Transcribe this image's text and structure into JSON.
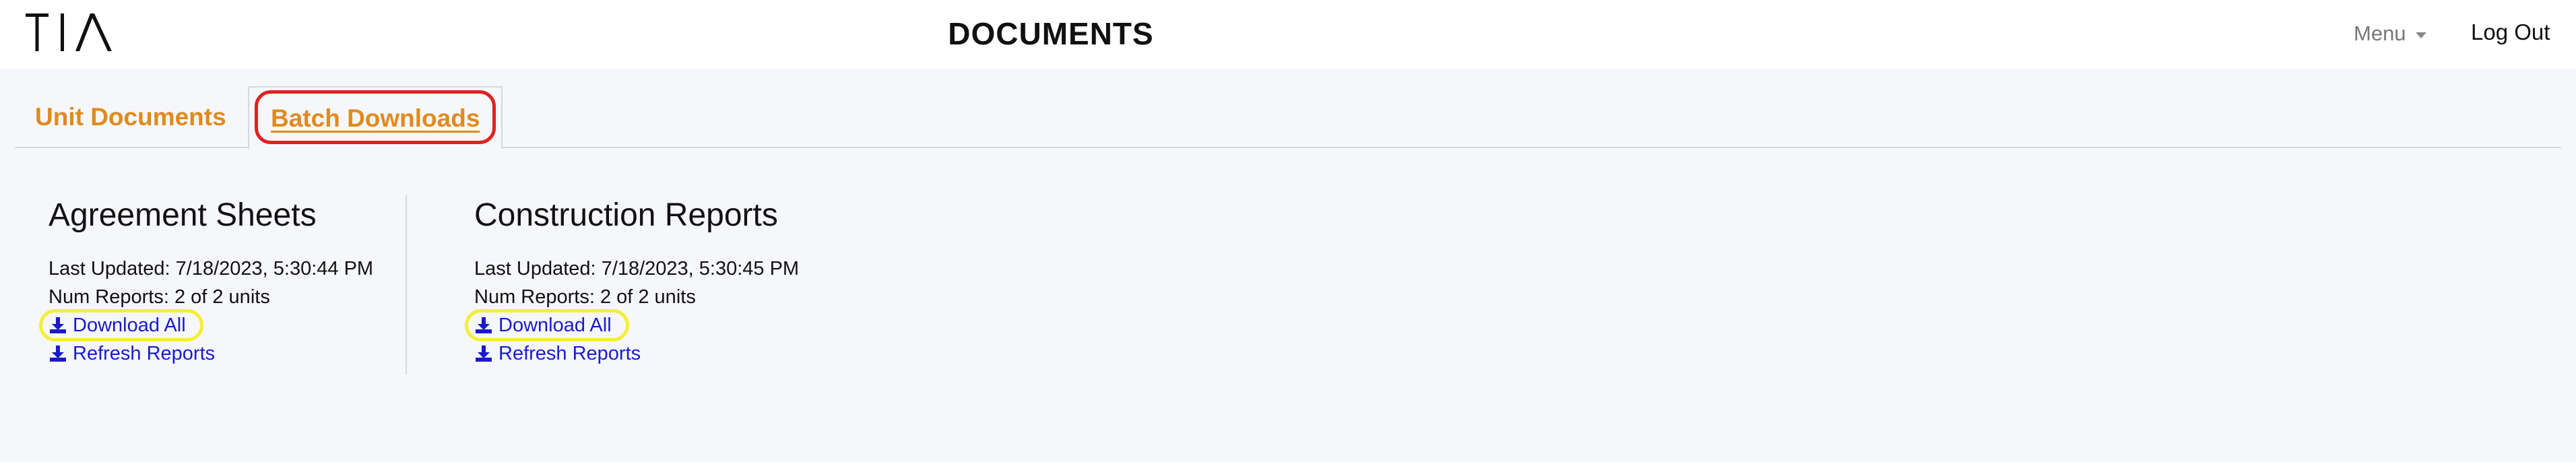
{
  "header": {
    "logo_text": "TIA",
    "title": "DOCUMENTS",
    "menu_label": "Menu",
    "logout_label": "Log Out"
  },
  "tabs": [
    {
      "label": "Unit Documents",
      "active": false
    },
    {
      "label": "Batch Downloads",
      "active": true
    }
  ],
  "sections": [
    {
      "title": "Agreement Sheets",
      "last_updated": "Last Updated: 7/18/2023, 5:30:44 PM",
      "num_reports": "Num Reports: 2 of 2 units",
      "download_label": "Download All",
      "refresh_label": "Refresh Reports"
    },
    {
      "title": "Construction Reports",
      "last_updated": "Last Updated: 7/18/2023, 5:30:45 PM",
      "num_reports": "Num Reports: 2 of 2 units",
      "download_label": "Download All",
      "refresh_label": "Refresh Reports"
    }
  ],
  "colors": {
    "accent_orange": "#e08a1e",
    "link_blue": "#1a1acc",
    "highlight_red": "#e02020",
    "highlight_yellow": "#f4ee3a"
  },
  "icons": {
    "download": "download-icon",
    "caret": "caret-down-icon"
  }
}
